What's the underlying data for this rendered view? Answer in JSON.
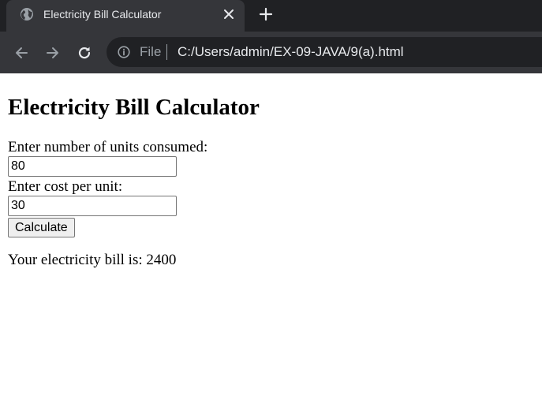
{
  "browser": {
    "tab": {
      "title": "Electricity Bill Calculator",
      "favicon": "globe-icon"
    },
    "address_bar": {
      "scheme_label": "File",
      "url": "C:/Users/admin/EX-09-JAVA/9(a).html"
    },
    "colors": {
      "tabstrip_bg": "#202124",
      "active_tab_bg": "#35363a",
      "text": "#e8eaed",
      "muted": "#9aa0a6"
    }
  },
  "page": {
    "heading": "Electricity Bill Calculator",
    "units_label": "Enter number of units consumed:",
    "units_value": "80",
    "cost_label": "Enter cost per unit:",
    "cost_value": "30",
    "calculate_label": "Calculate",
    "result_text": "Your electricity bill is: 2400"
  }
}
